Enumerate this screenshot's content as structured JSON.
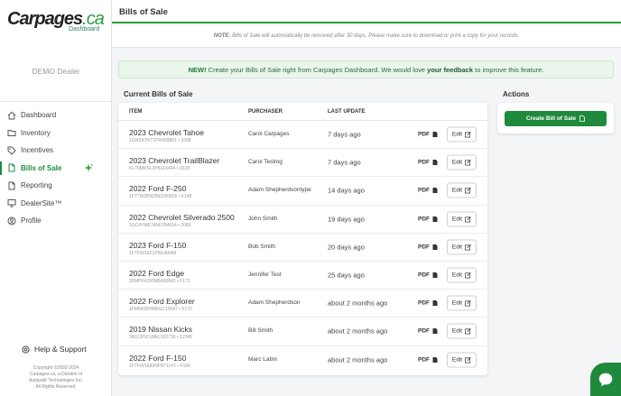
{
  "brand": {
    "logo_main": "Carpages",
    "logo_ca": ".ca",
    "logo_sub": "Dashboard",
    "accent": "#1f8a3c"
  },
  "sidebar": {
    "dealer": "DEMO Dealer",
    "items": [
      {
        "label": "Dashboard",
        "icon": "home-icon",
        "active": false
      },
      {
        "label": "Inventory",
        "icon": "folder-icon",
        "active": false
      },
      {
        "label": "Incentives",
        "icon": "tag-icon",
        "active": false
      },
      {
        "label": "Bills of Sale",
        "icon": "document-icon",
        "active": true
      },
      {
        "label": "Reporting",
        "icon": "document-icon",
        "active": false
      },
      {
        "label": "DealerSite™",
        "icon": "monitor-icon",
        "active": false
      },
      {
        "label": "Profile",
        "icon": "user-icon",
        "active": false
      }
    ],
    "help": "Help & Support",
    "copyright": [
      "Copyright ©2003-2024",
      "Carpages.ca, a Division of",
      "Autopath Technologies Inc.",
      "All Rights Reserved."
    ]
  },
  "header": {
    "title": "Bills of Sale"
  },
  "note": {
    "label": "NOTE:",
    "text": "Bills of Sale will automatically be removed after 30 days. Please make sure to download or print a copy for your records."
  },
  "banner": {
    "new": "NEW!",
    "text1": "Create your Bills of Sale right from Carpages Dashboard. We would love",
    "link": "your feedback",
    "text2": "to improve this feature."
  },
  "bills": {
    "title": "Current Bills of Sale",
    "columns": {
      "item": "ITEM",
      "purchaser": "PURCHASER",
      "last_update": "LAST UPDATE"
    },
    "pdf_label": "PDF",
    "edit_label": "Edit",
    "rows": [
      {
        "name": "2023 Chevrolet Tahoe",
        "sub": "1GNSKTKT1PR409861 • 3208",
        "purchaser": "Carol Carpages",
        "updated": "7 days ago"
      },
      {
        "name": "2023 Chevrolet TrailBlazer",
        "sub": "KL79MRSL2PB116494 • 3228",
        "purchaser": "Carol Testing",
        "updated": "7 days ago"
      },
      {
        "name": "2022 Ford F-250",
        "sub": "1FT7W2BN2NED60826 • F148",
        "purchaser": "Adam Shepherdsontype",
        "updated": "14 days ago"
      },
      {
        "name": "2022 Chevrolet Silverado 2500",
        "sub": "1GC4YME74NF254614 • 2083",
        "purchaser": "John Smith",
        "updated": "19 days ago"
      },
      {
        "name": "2023 Ford F-150",
        "sub": "1FTFW1E51PKE40049",
        "purchaser": "Bob Smith",
        "updated": "20 days ago"
      },
      {
        "name": "2022 Ford Edge",
        "sub": "2FMPK4J93NBA90842 • F172",
        "purchaser": "Jennifer Test",
        "updated": "25 days ago"
      },
      {
        "name": "2022 Ford Explorer",
        "sub": "1FM5K8DH9NGC10097 • F170",
        "purchaser": "Adam Shepherdson",
        "updated": "about 2 months ago"
      },
      {
        "name": "2019 Nissan Kicks",
        "sub": "3N1CP5CU8KL502736 • 12345",
        "purchaser": "Bill Smith",
        "updated": "about 2 months ago"
      },
      {
        "name": "2022 Ford F-150",
        "sub": "1FTFW1E83NFB71147 • F166",
        "purchaser": "Marc Latini",
        "updated": "about 2 months ago"
      }
    ]
  },
  "actions": {
    "title": "Actions",
    "create_label": "Create Bill of Sale"
  }
}
